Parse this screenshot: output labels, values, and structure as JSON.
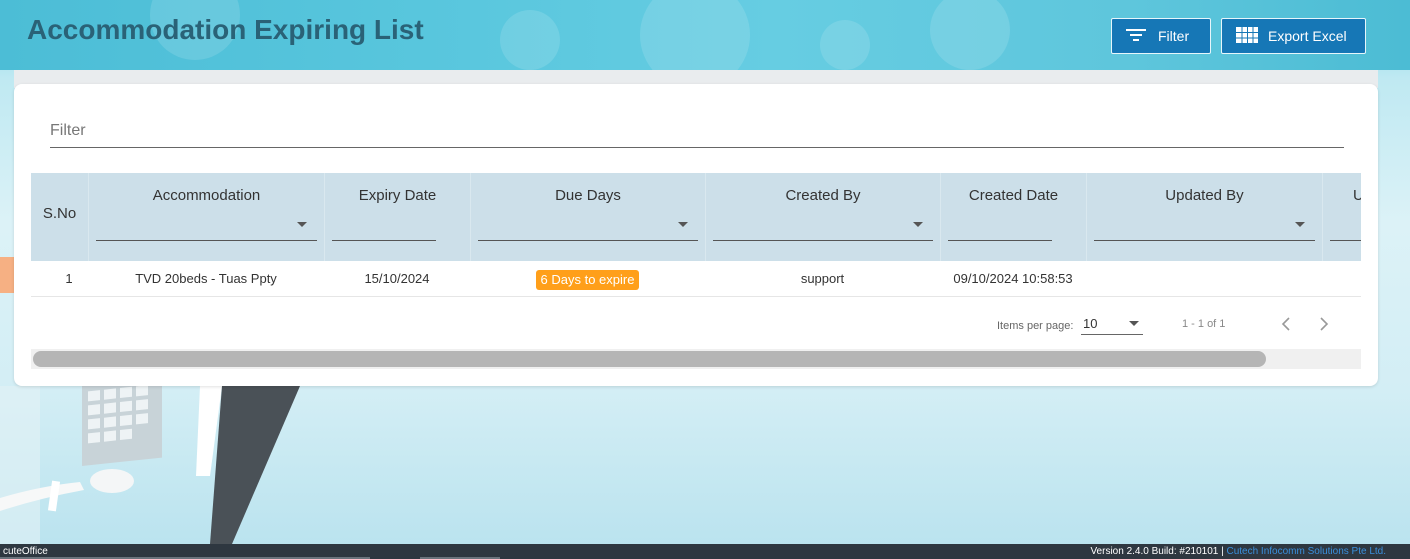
{
  "header": {
    "title": "Accommodation Expiring List",
    "filter_button": "Filter",
    "export_button": "Export Excel"
  },
  "filter": {
    "placeholder": "Filter"
  },
  "table": {
    "columns": [
      {
        "label": "S.No",
        "has_select": false
      },
      {
        "label": "Accommodation",
        "has_select": true
      },
      {
        "label": "Expiry Date",
        "has_select": true
      },
      {
        "label": "Due Days",
        "has_select": true
      },
      {
        "label": "Created By",
        "has_select": true
      },
      {
        "label": "Created Date",
        "has_select": true
      },
      {
        "label": "Updated By",
        "has_select": true
      },
      {
        "label": "Upda",
        "has_select": true
      }
    ],
    "rows": [
      {
        "sno": "1",
        "accommodation": "TVD 20beds - Tuas Ppty",
        "expiry_date": "15/10/2024",
        "due_days": "6 Days to expire",
        "created_by": "support",
        "created_date": "09/10/2024 10:58:53",
        "updated_by": "",
        "updated_date": ""
      }
    ]
  },
  "pagination": {
    "items_per_page_label": "Items per page:",
    "items_per_page": "10",
    "range": "1 - 1 of 1"
  },
  "colors": {
    "primary_button": "#1677b6",
    "badge_warning": "#ff9f1a",
    "table_header": "#ccdfe9",
    "title": "#2a6277"
  },
  "footer": {
    "app_name": "cuteOffice",
    "version_text": "Version 2.4.0 Build: #210101 | ",
    "company": "Cutech Infocomm Solutions Pte Ltd."
  }
}
